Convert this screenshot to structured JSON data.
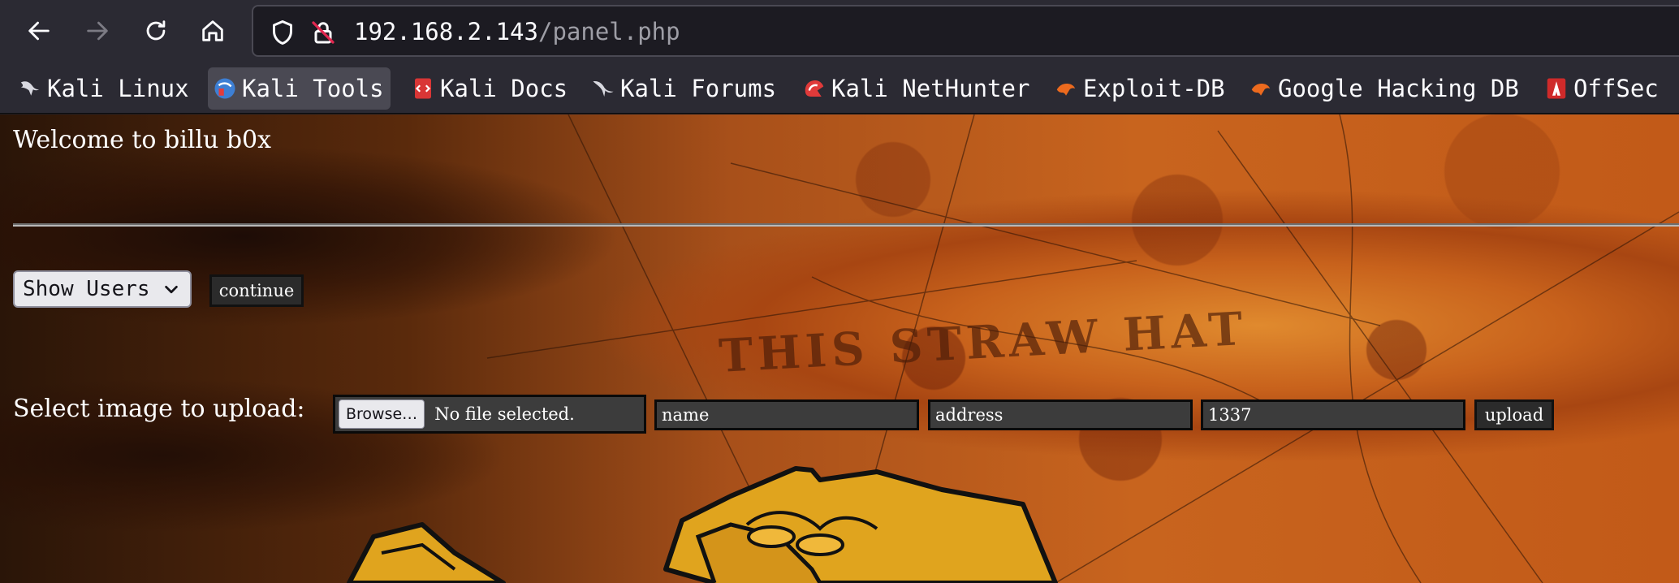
{
  "browser": {
    "url_host": "192.168.2.143",
    "url_path": "/panel.php"
  },
  "bookmarks": [
    {
      "label": "Kali Linux",
      "icon": "kali-dragon-icon"
    },
    {
      "label": "Kali Tools",
      "icon": "kali-tools-icon",
      "active": true
    },
    {
      "label": "Kali Docs",
      "icon": "kali-docs-icon"
    },
    {
      "label": "Kali Forums",
      "icon": "kali-forums-icon"
    },
    {
      "label": "Kali NetHunter",
      "icon": "kali-nethunter-icon"
    },
    {
      "label": "Exploit-DB",
      "icon": "exploit-db-icon"
    },
    {
      "label": "Google Hacking DB",
      "icon": "google-hacking-db-icon"
    },
    {
      "label": "OffSec",
      "icon": "offsec-icon"
    }
  ],
  "page": {
    "welcome": "Welcome to billu b0x",
    "users_select": {
      "selected": "Show Users"
    },
    "continue_label": "continue",
    "upload_label": "Select image to upload:",
    "file_picker": {
      "button": "Browse…",
      "status": "No file selected."
    },
    "fields": {
      "name": "name",
      "address": "address",
      "id": "1337"
    },
    "upload_button": "upload",
    "background_text": "THIS STRAW HAT"
  },
  "colors": {
    "toolbar": "#2b2a33",
    "urlbar": "#1c1b22",
    "page_background": "#c8641e",
    "form_control": "#3c3c3c"
  }
}
